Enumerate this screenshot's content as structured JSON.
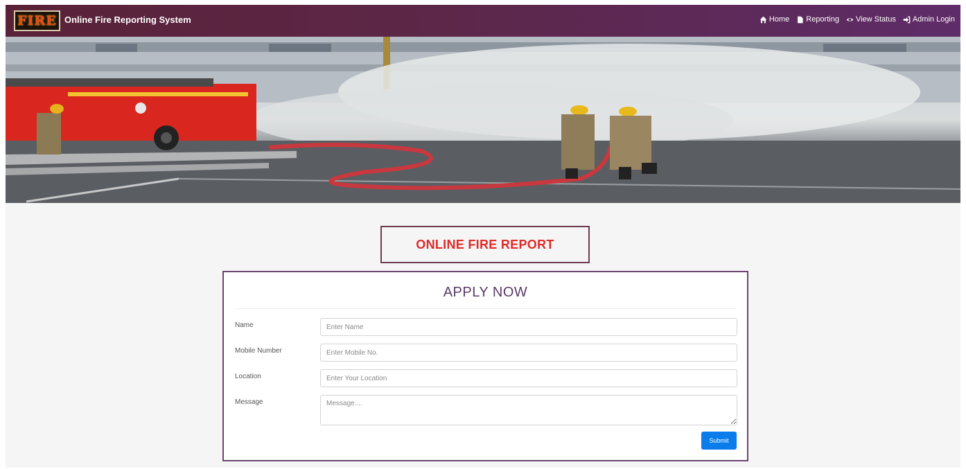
{
  "brand": {
    "logo_text": "FIRE",
    "title": "Online Fire Reporting System"
  },
  "nav": [
    {
      "icon": "home-icon",
      "label": "Home"
    },
    {
      "icon": "document-icon",
      "label": "Reporting"
    },
    {
      "icon": "eye-icon",
      "label": "View Status"
    },
    {
      "icon": "login-icon",
      "label": "Admin Login"
    }
  ],
  "hero": {
    "image": "firefighters-hose-photo"
  },
  "report_heading": "ONLINE FIRE REPORT",
  "form": {
    "title": "APPLY NOW",
    "fields": [
      {
        "label": "Name",
        "placeholder": "Enter Name",
        "value": ""
      },
      {
        "label": "Mobile Number",
        "placeholder": "Enter Mobile No.",
        "value": ""
      },
      {
        "label": "Location",
        "placeholder": "Enter Your Location",
        "value": ""
      },
      {
        "label": "Message",
        "placeholder": "Message....",
        "value": ""
      }
    ],
    "submit_label": "Submit"
  },
  "colors": {
    "navbar": "#5c2748",
    "heading_red": "#e02a2a",
    "card_border": "#6b4470",
    "submit_blue": "#0b7dea"
  }
}
